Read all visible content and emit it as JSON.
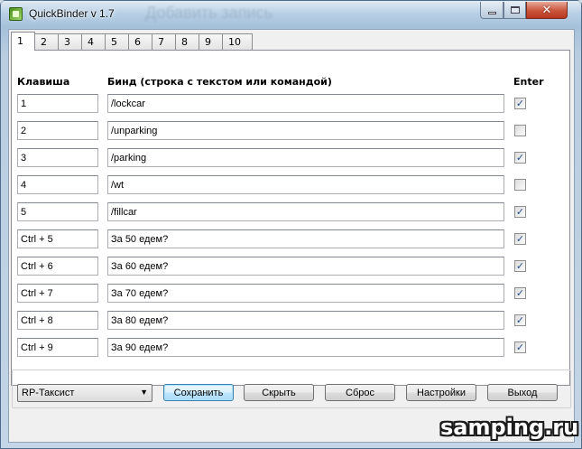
{
  "window": {
    "title": "QuickBinder v 1.7",
    "ghost_title": "Добавить запись"
  },
  "tabs": [
    {
      "label": "1",
      "active": true
    },
    {
      "label": "2"
    },
    {
      "label": "3"
    },
    {
      "label": "4"
    },
    {
      "label": "5"
    },
    {
      "label": "6"
    },
    {
      "label": "7"
    },
    {
      "label": "8"
    },
    {
      "label": "9"
    },
    {
      "label": "10"
    }
  ],
  "headers": {
    "key": "Клавиша",
    "bind": "Бинд (строка с текстом или командой)",
    "enter": "Enter"
  },
  "rows": [
    {
      "key": "1",
      "bind": "/lockcar",
      "enter": true
    },
    {
      "key": "2",
      "bind": "/unparking",
      "enter": false
    },
    {
      "key": "3",
      "bind": "/parking",
      "enter": true
    },
    {
      "key": "4",
      "bind": "/wt",
      "enter": false
    },
    {
      "key": "5",
      "bind": "/fillcar",
      "enter": true
    },
    {
      "key": "Ctrl + 5",
      "bind": "За 50 едем?",
      "enter": true
    },
    {
      "key": "Ctrl + 6",
      "bind": "За 60 едем?",
      "enter": true
    },
    {
      "key": "Ctrl + 7",
      "bind": "За 70 едем?",
      "enter": true
    },
    {
      "key": "Ctrl + 8",
      "bind": "За 80 едем?",
      "enter": true
    },
    {
      "key": "Ctrl + 9",
      "bind": "За 90 едем?",
      "enter": true
    }
  ],
  "profile": {
    "selected": "RP-Таксист"
  },
  "buttons": {
    "save": "Сохранить",
    "hide": "Скрыть",
    "reset": "Сброс",
    "settings": "Настройки",
    "exit": "Выход"
  },
  "watermark": "samping.ru"
}
